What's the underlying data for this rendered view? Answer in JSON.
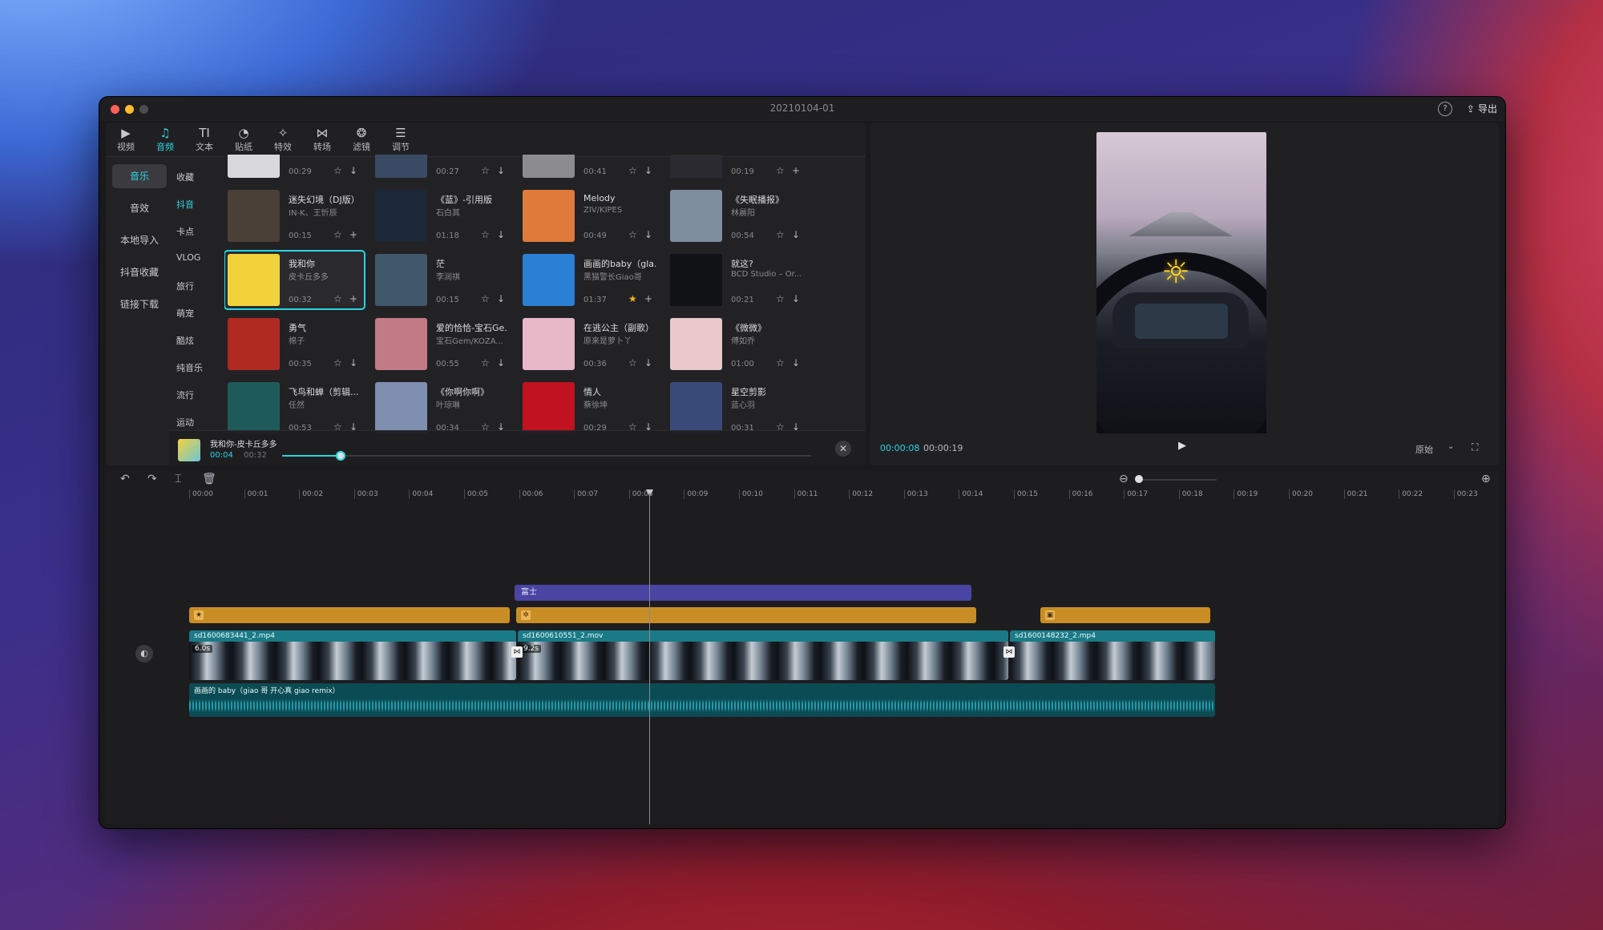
{
  "window": {
    "title": "20210104-01",
    "help": "?",
    "export_label": "导出"
  },
  "toolbar": [
    {
      "label": "视频",
      "icon": "▶"
    },
    {
      "label": "音频",
      "icon": "♫"
    },
    {
      "label": "文本",
      "icon": "TI"
    },
    {
      "label": "贴纸",
      "icon": "◔"
    },
    {
      "label": "特效",
      "icon": "✧"
    },
    {
      "label": "转场",
      "icon": "⋈"
    },
    {
      "label": "滤镜",
      "icon": "❂"
    },
    {
      "label": "调节",
      "icon": "☰"
    }
  ],
  "sidebar": [
    "音乐",
    "音效",
    "本地导入",
    "抖音收藏",
    "链接下载"
  ],
  "categories": [
    "收藏",
    "抖音",
    "卡点",
    "VLOG",
    "旅行",
    "萌宠",
    "酷炫",
    "纯音乐",
    "流行",
    "运动"
  ],
  "tracks": [
    {
      "title": "",
      "artist": "",
      "duration": "00:29",
      "starred": false,
      "action": "↓"
    },
    {
      "title": "",
      "artist": "",
      "duration": "00:27",
      "starred": false,
      "action": "↓"
    },
    {
      "title": "",
      "artist": "",
      "duration": "00:41",
      "starred": false,
      "action": "↓"
    },
    {
      "title": "",
      "artist": "",
      "duration": "00:19",
      "starred": false,
      "action": "+"
    },
    {
      "title": "迷失幻境（DJ版）",
      "artist": "IN-K、王忻辰",
      "duration": "00:15",
      "starred": false,
      "action": "+"
    },
    {
      "title": "《蓝》-引用版",
      "artist": "石白其",
      "duration": "01:18",
      "starred": false,
      "action": "↓"
    },
    {
      "title": "Melody",
      "artist": "ZIV/KIPES",
      "duration": "00:49",
      "starred": false,
      "action": "↓"
    },
    {
      "title": "《失眠播报》",
      "artist": "林晨阳",
      "duration": "00:54",
      "starred": false,
      "action": "↓"
    },
    {
      "title": "我和你",
      "artist": "皮卡丘多多",
      "duration": "00:32",
      "starred": false,
      "action": "+"
    },
    {
      "title": "茫",
      "artist": "李润祺",
      "duration": "00:15",
      "starred": false,
      "action": "↓"
    },
    {
      "title": "画画的baby（gla...",
      "artist": "黑猫警长Giao哥",
      "duration": "01:37",
      "starred": true,
      "action": "+"
    },
    {
      "title": "就这?",
      "artist": "BCD Studio – Or...",
      "duration": "00:21",
      "starred": false,
      "action": "↓"
    },
    {
      "title": "勇气",
      "artist": "棉子",
      "duration": "00:35",
      "starred": false,
      "action": "↓"
    },
    {
      "title": "爱的恰恰-宝石Ge...",
      "artist": "宝石Gem/KOZA...",
      "duration": "00:55",
      "starred": false,
      "action": "↓"
    },
    {
      "title": "在逃公主（副歌）",
      "artist": "原来是萝卜丫",
      "duration": "00:36",
      "starred": false,
      "action": "↓"
    },
    {
      "title": "《微微》",
      "artist": "傅如乔",
      "duration": "01:00",
      "starred": false,
      "action": "↓"
    },
    {
      "title": "飞鸟和蝉（剪辑...",
      "artist": "任然",
      "duration": "00:53",
      "starred": false,
      "action": "↓"
    },
    {
      "title": "《你啊你啊》",
      "artist": "叶琼琳",
      "duration": "00:34",
      "starred": false,
      "action": "↓"
    },
    {
      "title": "情人",
      "artist": "蔡徐坤",
      "duration": "00:29",
      "starred": false,
      "action": "↓"
    },
    {
      "title": "星空剪影",
      "artist": "蓝心羽",
      "duration": "00:31",
      "starred": false,
      "action": "↓"
    }
  ],
  "thumb_colors": [
    "#d9d9dc",
    "#3b4a64",
    "#8c8c90",
    "#2a2a30",
    "#4a4038",
    "#1c2738",
    "#e07a3a",
    "#7f8e9f",
    "#f2d23a",
    "#40586a",
    "#2b7fd4",
    "#111216",
    "#b02a22",
    "#c27a86",
    "#e8b7c8",
    "#e8c8c8",
    "#1f5a5a",
    "#7f8fb0",
    "#c1121f",
    "#3a4a78"
  ],
  "player": {
    "title": "我和你-皮卡丘多多",
    "current": "00:04",
    "total": "00:32",
    "progress": 0.11
  },
  "preview": {
    "current": "00:00:08",
    "total": "00:00:19",
    "ratio": "原始"
  },
  "timeline": {
    "ruler": [
      "00:00",
      "00:01",
      "00:02",
      "00:03",
      "00:04",
      "00:05",
      "00:06",
      "00:07",
      "00:08",
      "00:09",
      "00:10",
      "00:11",
      "00:12",
      "00:13",
      "00:14",
      "00:15",
      "00:16",
      "00:17",
      "00:18",
      "00:19",
      "00:20",
      "00:21",
      "00:22",
      "00:23"
    ],
    "text_clip": "富士",
    "videos": [
      {
        "name": "sd1600683441_2.mp4",
        "speed": "6.0s"
      },
      {
        "name": "sd1600610551_2.mov",
        "speed": "9.2s"
      },
      {
        "name": "sd1600148232_2.mp4",
        "speed": ""
      }
    ],
    "audio": "画画的 baby（giao 哥 开心真 giao remix）"
  },
  "colors": {
    "accent": "#2ad4e0",
    "fx": "#c98d25",
    "text_track": "#4a44a3",
    "video_header": "#1a7a86",
    "audio": "#0b4b54"
  }
}
